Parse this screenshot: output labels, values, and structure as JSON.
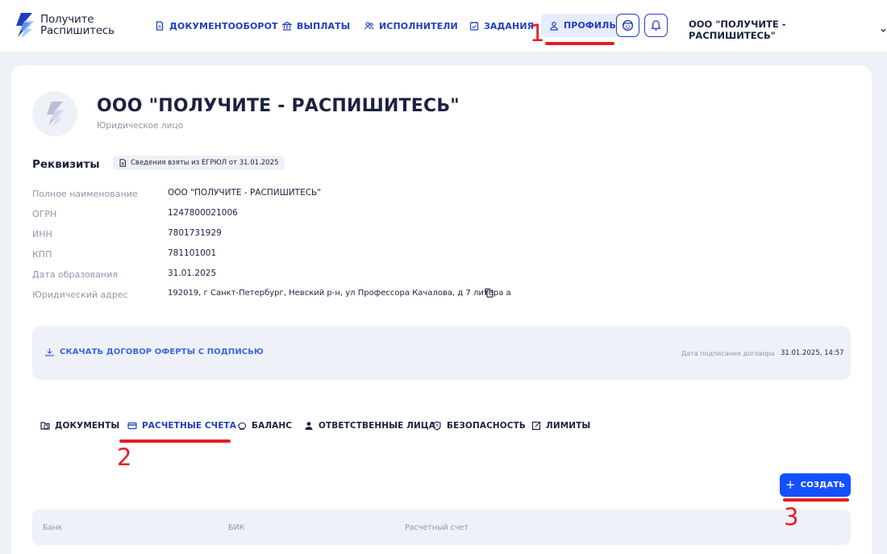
{
  "logo": {
    "line1": "Получите",
    "line2": "Распишитесь"
  },
  "nav": {
    "documents": "ДОКУМЕНТООБОРОТ",
    "payments": "ВЫПЛАТЫ",
    "executors": "ИСПОЛНИТЕЛИ",
    "tasks": "ЗАДАНИЯ",
    "profile": "ПРОФИЛЬ"
  },
  "header": {
    "company": "ООО \"ПОЛУЧИТЕ - РАСПИШИТЕСЬ\""
  },
  "org": {
    "name": "ООО \"ПОЛУЧИТЕ - РАСПИШИТЕСЬ\"",
    "type": "Юридическое лицо"
  },
  "requisites": {
    "title": "Реквизиты",
    "badge": "Сведения взяты из ЕГРЮЛ от 31.01.2025",
    "rows": [
      {
        "label": "Полное наименование",
        "value": "ООО \"ПОЛУЧИТЕ - РАСПИШИТЕСЬ\""
      },
      {
        "label": "ОГРН",
        "value": "1247800021006"
      },
      {
        "label": "ИНН",
        "value": "7801731929"
      },
      {
        "label": "КПП",
        "value": "781101001"
      },
      {
        "label": "Дата образования",
        "value": "31.01.2025"
      },
      {
        "label": "Юридический адрес",
        "value": "192019, г Санкт-Петербург, Невский р-н, ул Профессора Качалова, д 7 литера а"
      }
    ]
  },
  "contract": {
    "download": "СКАЧАТЬ ДОГОВОР ОФЕРТЫ С ПОДПИСЬЮ",
    "sign_label": "Дата подписания договора",
    "sign_value": "31.01.2025, 14:57"
  },
  "tabs": {
    "documents": "ДОКУМЕНТЫ",
    "accounts": "РАСЧЕТНЫЕ СЧЕТА",
    "balance": "БАЛАНС",
    "responsible": "ОТВЕТСТВЕННЫЕ ЛИЦА",
    "security": "БЕЗОПАСНОСТЬ",
    "limits": "ЛИМИТЫ"
  },
  "create_button": "СОЗДАТЬ",
  "table": {
    "headers": [
      "Банк",
      "БИК",
      "Расчетный счет"
    ]
  },
  "annotations": [
    "1",
    "2",
    "3"
  ],
  "colors": {
    "accent": "#1f3fbf",
    "button": "#1550ff",
    "annotation": "#e31e24",
    "background": "#eef1f7"
  }
}
